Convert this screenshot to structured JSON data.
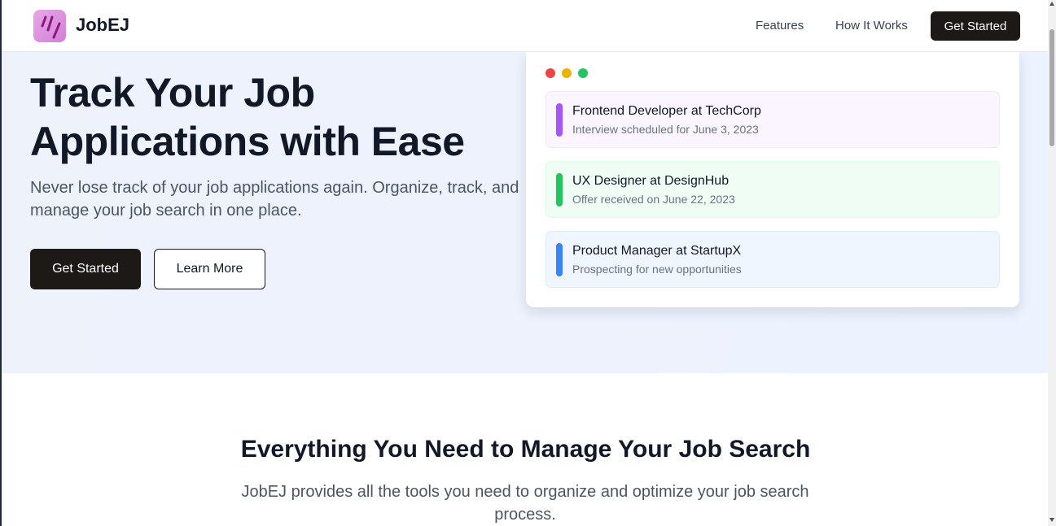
{
  "header": {
    "brand": "JobEJ",
    "logo_icon": "brand-slashes-icon",
    "nav": [
      {
        "label": "Features"
      },
      {
        "label": "How It Works"
      }
    ],
    "cta_label": "Get Started"
  },
  "hero": {
    "title": "Track Your Job Applications with Ease",
    "subtitle": "Never lose track of your job applications again. Organize, track, and manage your job search in one place.",
    "primary_button": "Get Started",
    "secondary_button": "Learn More"
  },
  "preview": {
    "window_controls": [
      "red",
      "yellow",
      "green"
    ],
    "applications": [
      {
        "title": "Frontend Developer at TechCorp",
        "status": "Interview scheduled for June 3, 2023",
        "accent": "#a855f7"
      },
      {
        "title": "UX Designer at DesignHub",
        "status": "Offer received on June 22, 2023",
        "accent": "#22c55e"
      },
      {
        "title": "Product Manager at StartupX",
        "status": "Prospecting for new opportunities",
        "accent": "#3b82f6"
      }
    ]
  },
  "features": {
    "title": "Everything You Need to Manage Your Job Search",
    "subtitle": "JobEJ provides all the tools you need to organize and optimize your job search process."
  },
  "colors": {
    "primary": "#1c1917",
    "hero_background": "#edf2fd",
    "logo_gradient": "#d17fd8"
  }
}
